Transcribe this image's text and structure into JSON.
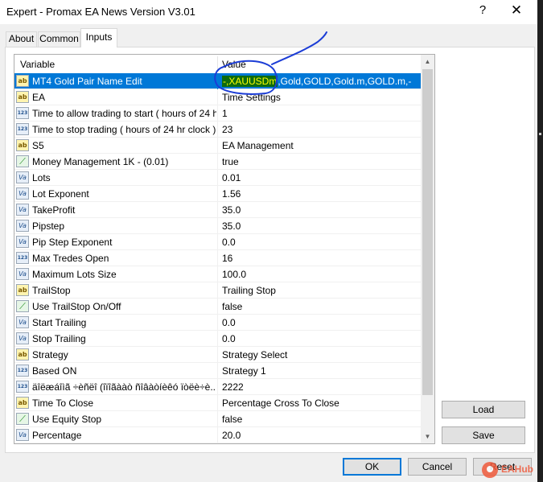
{
  "window": {
    "title": "Expert - Promax EA News Version V3.01",
    "help_glyph": "?",
    "close_glyph": "✕"
  },
  "tabs": [
    {
      "label": "About",
      "active": false
    },
    {
      "label": "Common",
      "active": false
    },
    {
      "label": "Inputs",
      "active": true
    }
  ],
  "grid": {
    "columns": {
      "variable": "Variable",
      "value": "Value"
    },
    "rows": [
      {
        "icon": "string-icon",
        "glyph": "ab",
        "name": "MT4 Gold Pair Name Edit",
        "value_highlight": "-,XAUUSDm",
        "value_rest": ",Gold,GOLD,Gold.m,GOLD.m,-",
        "selected": true
      },
      {
        "icon": "string-icon",
        "glyph": "ab",
        "name": "EA",
        "value": "Time Settings"
      },
      {
        "icon": "integer-icon",
        "glyph": "123",
        "name": "Time to allow trading to start ( hours of 24 hr cl...",
        "value": "1"
      },
      {
        "icon": "integer-icon",
        "glyph": "123",
        "name": "Time to stop trading ( hours of 24 hr clock )",
        "value": "23"
      },
      {
        "icon": "string-icon",
        "glyph": "ab",
        "name": "S5",
        "value": "EA Management"
      },
      {
        "icon": "boolean-icon",
        "glyph": "⟋",
        "name": "Money Management 1K - (0.01)",
        "value": "true"
      },
      {
        "icon": "double-icon",
        "glyph": "Va",
        "name": "Lots",
        "value": "0.01"
      },
      {
        "icon": "double-icon",
        "glyph": "Va",
        "name": "Lot Exponent",
        "value": "1.56"
      },
      {
        "icon": "double-icon",
        "glyph": "Va",
        "name": "TakeProfit",
        "value": "35.0"
      },
      {
        "icon": "double-icon",
        "glyph": "Va",
        "name": "Pipstep",
        "value": "35.0"
      },
      {
        "icon": "double-icon",
        "glyph": "Va",
        "name": "Pip Step Exponent",
        "value": "0.0"
      },
      {
        "icon": "integer-icon",
        "glyph": "123",
        "name": "Max Tredes Open",
        "value": "16"
      },
      {
        "icon": "double-icon",
        "glyph": "Va",
        "name": "Maximum Lots Size",
        "value": "100.0"
      },
      {
        "icon": "string-icon",
        "glyph": "ab",
        "name": "TrailStop",
        "value": "Trailing Stop"
      },
      {
        "icon": "boolean-icon",
        "glyph": "⟋",
        "name": "Use TrailStop On/Off",
        "value": "false"
      },
      {
        "icon": "double-icon",
        "glyph": "Va",
        "name": "Start Trailing",
        "value": "0.0"
      },
      {
        "icon": "double-icon",
        "glyph": "Va",
        "name": "Stop Trailing",
        "value": "0.0"
      },
      {
        "icon": "string-icon",
        "glyph": "ab",
        "name": "Strategy",
        "value": "Strategy Select"
      },
      {
        "icon": "integer-icon",
        "glyph": "123",
        "name": "Based ON",
        "value": "Strategy 1"
      },
      {
        "icon": "integer-icon",
        "glyph": "123",
        "name": "äîëæáîìã ÷èñëî (îïîãààò ñîâàòíèêó ïòëè÷è...",
        "value": "2222"
      },
      {
        "icon": "string-icon",
        "glyph": "ab",
        "name": "Time To Close",
        "value": "Percentage Cross To Close"
      },
      {
        "icon": "boolean-icon",
        "glyph": "⟋",
        "name": "Use Equity Stop",
        "value": "false"
      },
      {
        "icon": "double-icon",
        "glyph": "Va",
        "name": "Percentage",
        "value": "20.0"
      }
    ]
  },
  "scrollbar": {
    "up_glyph": "▲",
    "down_glyph": "▼"
  },
  "buttons": {
    "load": "Load",
    "save": "Save",
    "ok": "OK",
    "cancel": "Cancel",
    "reset": "Reset"
  },
  "watermark": {
    "text": "EAHub"
  },
  "colors": {
    "selection": "#0078d7",
    "highlight_bg": "#0d6b0d",
    "highlight_fg": "#ffff00",
    "annotation_ink": "#1c3dd6"
  }
}
